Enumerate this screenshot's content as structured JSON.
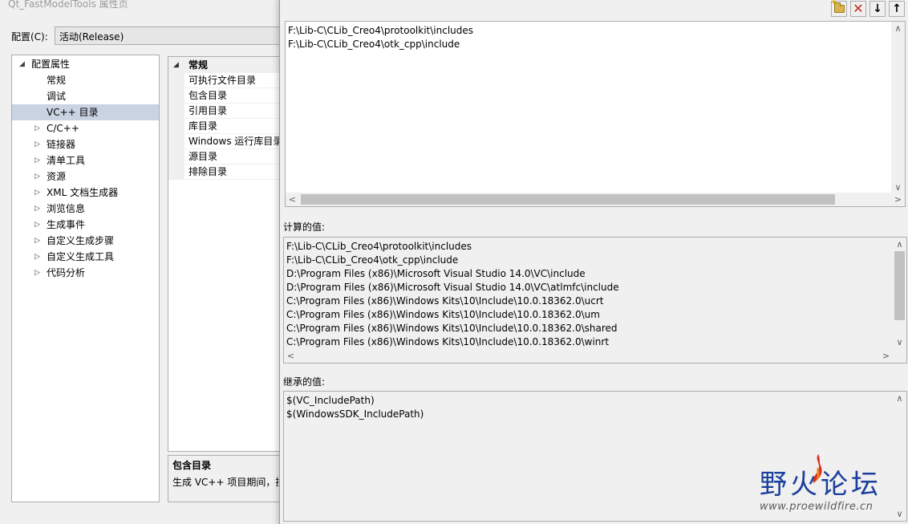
{
  "window_title": "Qt_FastModelTools 属性页",
  "config": {
    "label": "配置(C):",
    "value": "活动(Release)"
  },
  "tree": {
    "items": [
      {
        "label": "配置属性",
        "arrow": "◢",
        "level": 0
      },
      {
        "label": "常规",
        "arrow": "",
        "level": 1
      },
      {
        "label": "调试",
        "arrow": "",
        "level": 1
      },
      {
        "label": "VC++ 目录",
        "arrow": "",
        "level": 1,
        "selected": true
      },
      {
        "label": "C/C++",
        "arrow": "▷",
        "level": 1
      },
      {
        "label": "链接器",
        "arrow": "▷",
        "level": 1
      },
      {
        "label": "清单工具",
        "arrow": "▷",
        "level": 1
      },
      {
        "label": "资源",
        "arrow": "▷",
        "level": 1
      },
      {
        "label": "XML 文档生成器",
        "arrow": "▷",
        "level": 1
      },
      {
        "label": "浏览信息",
        "arrow": "▷",
        "level": 1
      },
      {
        "label": "生成事件",
        "arrow": "▷",
        "level": 1
      },
      {
        "label": "自定义生成步骤",
        "arrow": "▷",
        "level": 1
      },
      {
        "label": "自定义生成工具",
        "arrow": "▷",
        "level": 1
      },
      {
        "label": "代码分析",
        "arrow": "▷",
        "level": 1
      }
    ]
  },
  "grid": {
    "category": "常规",
    "category_arrow": "◢",
    "rows": [
      "可执行文件目录",
      "包含目录",
      "引用目录",
      "库目录",
      "Windows 运行库目录",
      "源目录",
      "排除目录"
    ]
  },
  "description": {
    "title": "包含目录",
    "text": "生成 VC++ 项目期间，搜"
  },
  "dialog": {
    "toolbar": {
      "new_line_icon": "new-folder-icon",
      "delete_glyph": "✕",
      "down_glyph": "↓",
      "up_glyph": "↑"
    },
    "edit_lines": [
      "F:\\Lib-C\\CLib_Creo4\\protoolkit\\includes",
      "F:\\Lib-C\\CLib_Creo4\\otk_cpp\\include"
    ],
    "calc_label": "计算的值:",
    "calc_lines": [
      "F:\\Lib-C\\CLib_Creo4\\protoolkit\\includes",
      "F:\\Lib-C\\CLib_Creo4\\otk_cpp\\include",
      "D:\\Program Files (x86)\\Microsoft Visual Studio 14.0\\VC\\include",
      "D:\\Program Files (x86)\\Microsoft Visual Studio 14.0\\VC\\atlmfc\\include",
      "C:\\Program Files (x86)\\Windows Kits\\10\\Include\\10.0.18362.0\\ucrt",
      "C:\\Program Files (x86)\\Windows Kits\\10\\Include\\10.0.18362.0\\um",
      "C:\\Program Files (x86)\\Windows Kits\\10\\Include\\10.0.18362.0\\shared",
      "C:\\Program Files (x86)\\Windows Kits\\10\\Include\\10.0.18362.0\\winrt"
    ],
    "inherited_label": "继承的值:",
    "inherited_lines": [
      "$(VC_IncludePath)",
      "$(WindowsSDK_IncludePath)"
    ]
  },
  "watermark": {
    "text": "野火论坛",
    "url": "www.proewildfire.cn"
  }
}
